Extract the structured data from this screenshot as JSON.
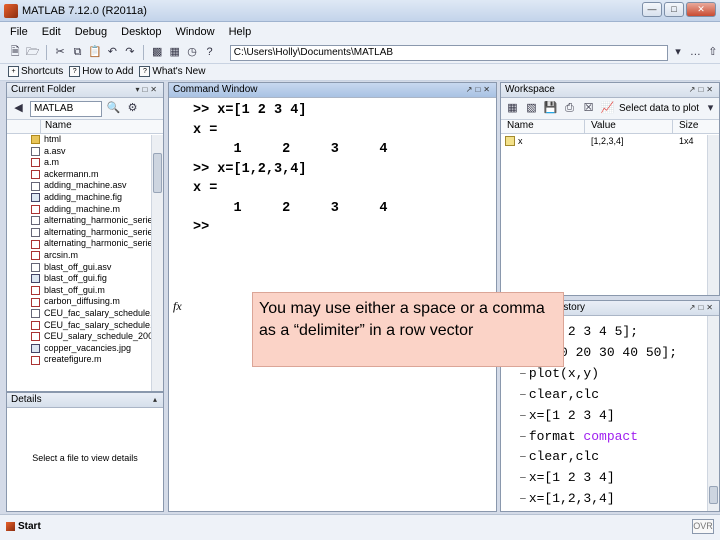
{
  "window": {
    "title": "MATLAB  7.12.0 (R2011a)"
  },
  "menu": [
    "File",
    "Edit",
    "Debug",
    "Desktop",
    "Window",
    "Help"
  ],
  "toolbar": {
    "path": "C:\\Users\\Holly\\Documents\\MATLAB"
  },
  "shortcuts": [
    "Shortcuts",
    "How to Add",
    "What's New"
  ],
  "current_folder": {
    "title": "Current Folder",
    "location": "MATLAB",
    "column_name": "Name",
    "files": [
      {
        "name": "html",
        "icon": "folder"
      },
      {
        "name": "a.asv",
        "icon": "doc"
      },
      {
        "name": "a.m",
        "icon": "m"
      },
      {
        "name": "ackermann.m",
        "icon": "m"
      },
      {
        "name": "adding_machine.asv",
        "icon": "doc"
      },
      {
        "name": "adding_machine.fig",
        "icon": "fig"
      },
      {
        "name": "adding_machine.m",
        "icon": "m"
      },
      {
        "name": "alternating_harmonic_serie...",
        "icon": "doc"
      },
      {
        "name": "alternating_harmonic_serie...",
        "icon": "doc"
      },
      {
        "name": "alternating_harmonic_serie...",
        "icon": "m"
      },
      {
        "name": "arcsin.m",
        "icon": "m"
      },
      {
        "name": "blast_off_gui.asv",
        "icon": "doc"
      },
      {
        "name": "blast_off_gui.fig",
        "icon": "fig"
      },
      {
        "name": "blast_off_gui.m",
        "icon": "m"
      },
      {
        "name": "carbon_diffusing.m",
        "icon": "m"
      },
      {
        "name": "CEU_fac_salary_schedule.asv",
        "icon": "doc"
      },
      {
        "name": "CEU_fac_salary_schedule.m",
        "icon": "m"
      },
      {
        "name": "CEU_salary_schedule_200...",
        "icon": "m"
      },
      {
        "name": "copper_vacancies.jpg",
        "icon": "fig"
      },
      {
        "name": "createfigure.m",
        "icon": "m"
      }
    ]
  },
  "details": {
    "title": "Details",
    "message": "Select a file to view details"
  },
  "command_window": {
    "title": "Command Window",
    "lines": [
      ">> x=[1 2 3 4]",
      "x =",
      "     1     2     3     4",
      ">> x=[1,2,3,4]",
      "x =",
      "     1     2     3     4"
    ],
    "prompt": ">>",
    "fx": "fx"
  },
  "workspace": {
    "title": "Workspace",
    "select_label": "Select data to plot",
    "columns": [
      "Name",
      "Value",
      "Size"
    ],
    "rows": [
      {
        "name": "x",
        "value": "[1,2,3,4]",
        "size": "1x4"
      }
    ]
  },
  "history": {
    "title": "Command History",
    "lines": [
      "x=[1 2 3 4 5];",
      "y=[10 20 30 40 50];",
      "plot(x,y)",
      "clear,clc",
      "x=[1 2 3 4]",
      "format compact",
      "clear,clc",
      "x=[1 2 3 4]",
      "x=[1,2,3,4]"
    ]
  },
  "callout": {
    "text": "You may use either a space or a comma as a “delimiter” in a row vector"
  },
  "statusbar": {
    "start": "Start",
    "mode": "OVR"
  }
}
